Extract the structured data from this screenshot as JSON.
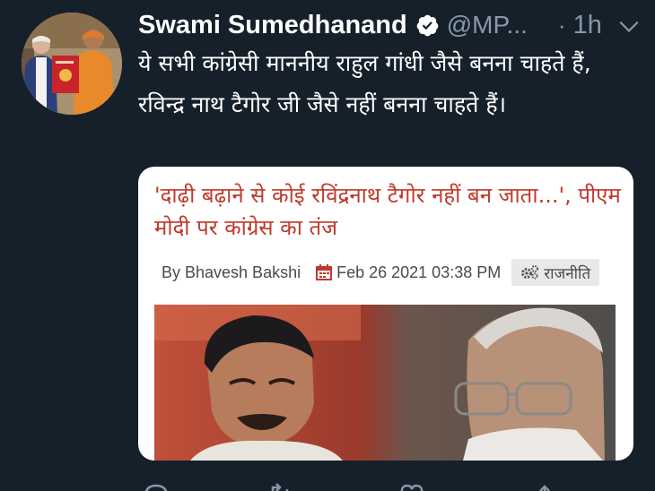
{
  "tweet": {
    "display_name": "Swami Sumedhanand",
    "handle": "@MP...",
    "separator": "·",
    "time": "1h",
    "text": "ये सभी कांग्रेसी माननीय राहुल गांधी जैसे बनना चाहते हैं,  रविन्द्र नाथ  टैगोर जी जैसे नहीं बनना चाहते हैं।"
  },
  "card": {
    "headline": "'दाढ़ी बढ़ाने से कोई रविंद्रनाथ टैगोर नहीं बन जाता...', पीएम मोदी पर कांग्रेस का तंज",
    "author": "By Bhavesh Bakshi",
    "date": "Feb 26 2021 03:38 PM",
    "category": "राजनीति"
  },
  "icons": {
    "verified": "verified-badge-icon",
    "more": "chevron-down-icon",
    "calendar": "calendar-icon",
    "category": "gears-icon",
    "actions": [
      "reply-icon",
      "retweet-icon",
      "like-icon",
      "share-icon"
    ]
  },
  "colors": {
    "background": "#15202b",
    "secondary_text": "#8899a6",
    "headline": "#c0392b",
    "verified": "#ffffff"
  }
}
